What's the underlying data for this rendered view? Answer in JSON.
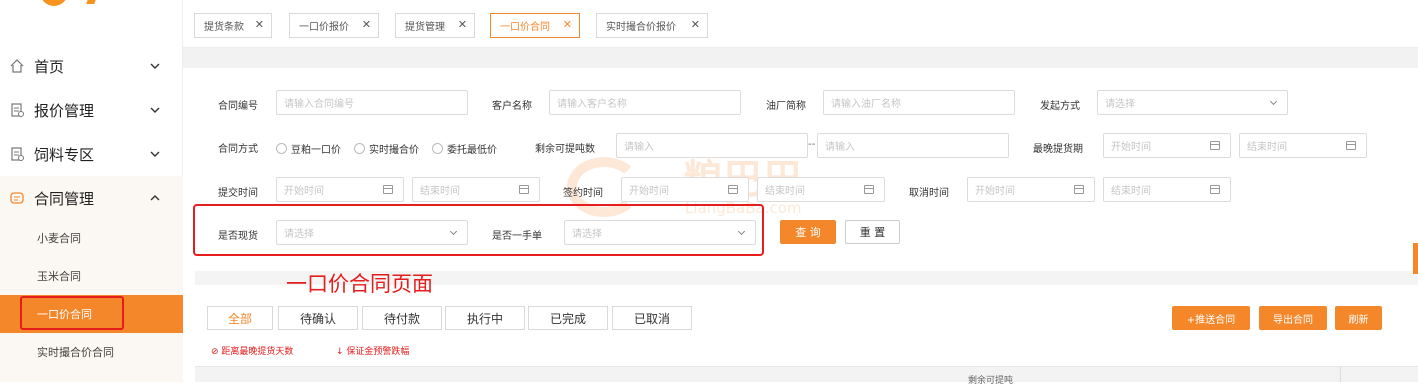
{
  "sidebar": {
    "items": [
      {
        "label": "首页",
        "icon": "home-icon"
      },
      {
        "label": "报价管理",
        "icon": "document-icon"
      },
      {
        "label": "饲料专区",
        "icon": "document-icon"
      },
      {
        "label": "合同管理",
        "icon": "contract-icon"
      }
    ],
    "sub_items": [
      {
        "label": "小麦合同"
      },
      {
        "label": "玉米合同"
      },
      {
        "label": "一口价合同"
      },
      {
        "label": "实时撮合价合同"
      }
    ]
  },
  "tabs": [
    {
      "label": "提货条款"
    },
    {
      "label": "一口价报价"
    },
    {
      "label": "提货管理"
    },
    {
      "label": "一口价合同"
    },
    {
      "label": "实时撮合价报价"
    }
  ],
  "form": {
    "contract_no_label": "合同编号",
    "contract_no_placeholder": "请输入合同编号",
    "customer_label": "客户名称",
    "customer_placeholder": "请输入客户名称",
    "factory_label": "油厂简称",
    "factory_placeholder": "请输入油厂名称",
    "initiate_label": "发起方式",
    "initiate_placeholder": "请选择",
    "method_label": "合同方式",
    "method_options": [
      "豆粕一口价",
      "实时撮合价",
      "委托最低价"
    ],
    "remaining_label": "剩余可提吨数",
    "remaining_from_placeholder": "请输入",
    "range_sep": "--",
    "remaining_to_placeholder": "请输入",
    "latest_pickup_label": "最晚提货期",
    "start_placeholder": "开始时间",
    "end_placeholder": "结束时间",
    "submit_time_label": "提交时间",
    "sign_time_label": "签约时间",
    "cancel_time_label": "取消时间",
    "spot_label": "是否现货",
    "spot_placeholder": "请选择",
    "first_hand_label": "是否一手单",
    "first_hand_placeholder": "请选择",
    "query_button": "查 询",
    "reset_button": "重 置"
  },
  "caption": "一口价合同页面",
  "status_tabs": [
    "全部",
    "待确认",
    "待付款",
    "执行中",
    "已完成",
    "已取消"
  ],
  "actions": {
    "push_button": "+推送合同",
    "export_button": "导出合同",
    "refresh_button": "刷新"
  },
  "notes": {
    "deadline_note": "⊘ 距离最晚提货天数",
    "margin_note": "↓ 保证金预警跌幅"
  },
  "table": {
    "header_partial": "剩余可提吨"
  },
  "watermark": {
    "cn": "粮巴巴",
    "en": "LiangBaBa.com"
  },
  "colors": {
    "accent": "#f5872b",
    "annotation_red": "#e51d1d"
  }
}
